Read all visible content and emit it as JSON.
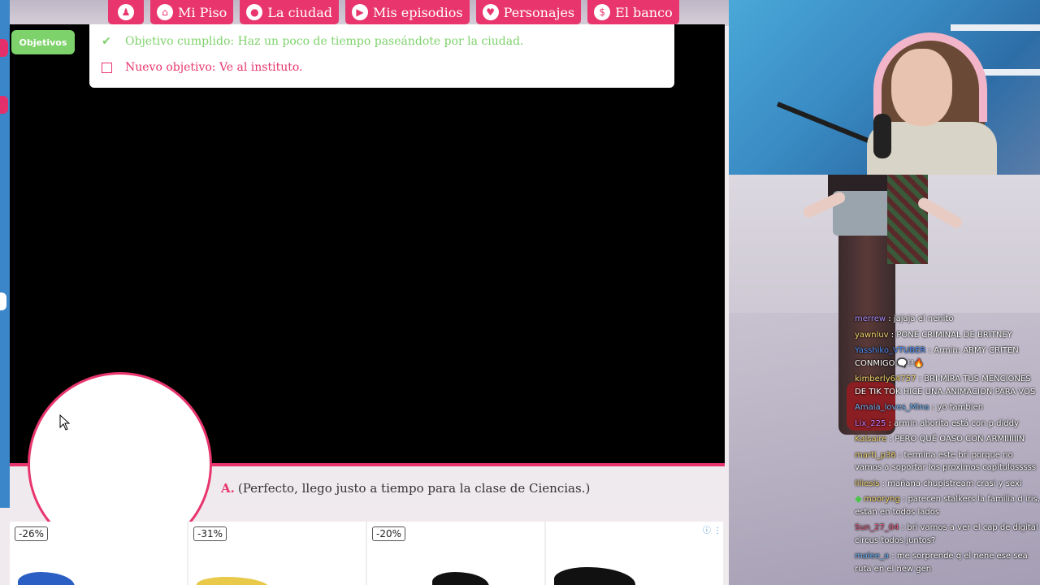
{
  "nav": {
    "items": [
      {
        "label": ""
      },
      {
        "label": "Mi Piso"
      },
      {
        "label": "La ciudad"
      },
      {
        "label": "Mis episodios"
      },
      {
        "label": "Personajes"
      },
      {
        "label": "El banco"
      }
    ]
  },
  "objectives": {
    "tab_label": "Objetivos",
    "completed": "Objetivo cumplido: Haz un poco de tiempo paseándote por la ciudad.",
    "new": "Nuevo objetivo: Ve al instituto."
  },
  "dialog": {
    "speaker": "A.",
    "text": "(Perfecto, llego justo a tiempo para la clase de Ciencias.)"
  },
  "ads": {
    "discounts": [
      "-26%",
      "-31%",
      "-20%",
      ""
    ]
  },
  "colors": {
    "accent": "#e8356d",
    "success": "#7ed26b"
  },
  "chat": [
    {
      "user": "merrew",
      "color": "#a78bfa",
      "text": "jajaja el nenito"
    },
    {
      "user": "yawnluv",
      "color": "#f5d76e",
      "text": "PONE CRIMINAL DE BRITNEY"
    },
    {
      "user": "Yasshiko_VTUBER",
      "color": "#4f8ef7",
      "text": "Armin: ARMY CRITEN CONMIGO.🗨️!!🔥"
    },
    {
      "user": "kimberly64757",
      "color": "#f5d76e",
      "text": "BRI MIRA TUS MENCIONES DE TIK TOK HICE UNA ANIMACION PARA VOS"
    },
    {
      "user": "Amaia_loves_Mina",
      "color": "#6cb4f5",
      "text": "yo tambien"
    },
    {
      "user": "Lix_225",
      "color": "#c77dff",
      "text": "armin ahorita está con p diddy"
    },
    {
      "user": "Kalsaire",
      "color": "#f5d76e",
      "text": "PERO QUÉ OASO CON ARMIIIIIIN"
    },
    {
      "user": "marti_p36",
      "color": "#f5d76e",
      "text": "termina este bri porque no vamos a soportar los proximos capitulosssss"
    },
    {
      "user": "liliesis",
      "color": "#f5d76e",
      "text": "mañana chupistream crasi y sexi"
    },
    {
      "user": "mooryng",
      "color": "#f5d76e",
      "text": "parecen stalkers la familia d iris, estan en todos lados"
    },
    {
      "user": "Sun_27_04",
      "color": "#e05a7a",
      "text": "bri vamos a ver el cap de digital circus todos juntos?"
    },
    {
      "user": "malee_a",
      "color": "#6cb4f5",
      "text": "me sorprende q el nene ese sea ruta en el new gen"
    }
  ]
}
